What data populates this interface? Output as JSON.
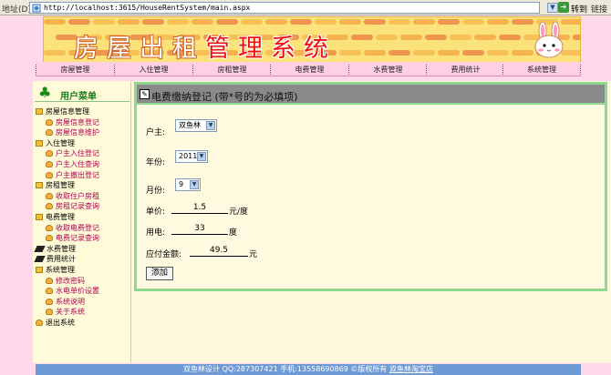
{
  "browser": {
    "address_label": "地址(D)",
    "url": "http://localhost:3615/HouseRentSystem/main.aspx",
    "go_label": "转到",
    "links_label": "链接"
  },
  "banner": {
    "title_white": "房屋出租",
    "title_red": "管理系统"
  },
  "nav": {
    "items": [
      "房屋管理",
      "入住管理",
      "房租管理",
      "电费管理",
      "水费管理",
      "费用统计",
      "系统管理"
    ]
  },
  "sidebar": {
    "title": "用户菜单",
    "items": [
      {
        "label": "房屋信息管理",
        "kind": "category",
        "icon": "folder-icon"
      },
      {
        "label": "房屋信息登记",
        "kind": "sub",
        "icon": "leaf-icon"
      },
      {
        "label": "房屋信息维护",
        "kind": "sub",
        "icon": "leaf-icon"
      },
      {
        "label": "入住管理",
        "kind": "category",
        "icon": "folder-icon"
      },
      {
        "label": "户主入住登记",
        "kind": "sub",
        "icon": "leaf-icon"
      },
      {
        "label": "户主入住查询",
        "kind": "sub",
        "icon": "leaf-icon"
      },
      {
        "label": "户主撤出登记",
        "kind": "sub",
        "icon": "leaf-icon"
      },
      {
        "label": "房租管理",
        "kind": "category",
        "icon": "folder-icon"
      },
      {
        "label": "收取住户房租",
        "kind": "sub",
        "icon": "leaf-icon"
      },
      {
        "label": "房租记录查询",
        "kind": "sub",
        "icon": "leaf-icon"
      },
      {
        "label": "电费管理",
        "kind": "category",
        "icon": "folder-icon"
      },
      {
        "label": "收取电费登记",
        "kind": "sub",
        "icon": "leaf-icon"
      },
      {
        "label": "电费记录查询",
        "kind": "sub",
        "icon": "leaf-icon"
      },
      {
        "label": "水费管理",
        "kind": "category",
        "icon": "pencil-icon"
      },
      {
        "label": "费用统计",
        "kind": "category",
        "icon": "pencil-icon"
      },
      {
        "label": "系统管理",
        "kind": "category",
        "icon": "folder-icon"
      },
      {
        "label": "修改密码",
        "kind": "sub",
        "icon": "leaf-icon"
      },
      {
        "label": "水电单价设置",
        "kind": "sub",
        "icon": "leaf-icon"
      },
      {
        "label": "系统说明",
        "kind": "sub",
        "icon": "leaf-icon"
      },
      {
        "label": "关于系统",
        "kind": "sub",
        "icon": "leaf-icon"
      },
      {
        "label": "退出系统",
        "kind": "category",
        "icon": "leaf-icon"
      }
    ]
  },
  "form": {
    "title": "电费缴纳登记 (带*号的为必填项)",
    "owner_label": "户主:",
    "owner_value": "双鱼林",
    "year_label": "年份:",
    "year_value": "2011",
    "month_label": "月份:",
    "month_value": "9",
    "price_label": "单价:",
    "price_value": "1.5",
    "price_unit": "元/度",
    "usage_label": "用电:",
    "usage_value": "33",
    "usage_unit": "度",
    "amount_label": "应付金额:",
    "amount_value": "49.5",
    "amount_unit": "元",
    "submit_label": "添加"
  },
  "footer": {
    "text": "双鱼林设计 QQ:287307421 手机:13558690869 ©版权所有",
    "link": "双鱼林淘宝店"
  },
  "colors": {
    "page_bg": "#ffd9ea",
    "banner_bg": "#fbe27a",
    "form_border": "#8fd88f",
    "form_header": "#8a8a8a",
    "footer_bg": "#6e9bd6",
    "submenu_text": "#b00050"
  }
}
